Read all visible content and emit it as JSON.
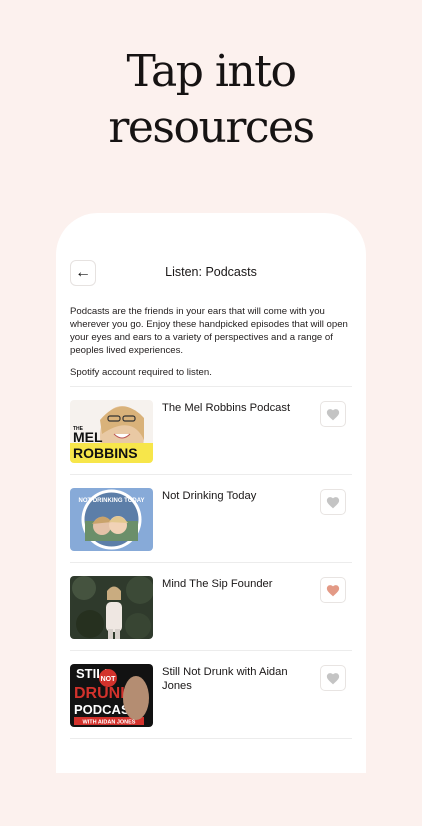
{
  "hero": {
    "line1": "Tap into",
    "line2": "resources"
  },
  "header": {
    "title": "Listen: Podcasts",
    "back_icon": "arrow-left-icon"
  },
  "intro_text": "Podcasts are the friends in your ears that will come with you wherever you go. Enjoy these handpicked episodes that will open your eyes and ears to a variety of perspectives and a range of peoples lived experiences.",
  "note_text": "Spotify account required to listen.",
  "podcasts": [
    {
      "title": "The Mel Robbins Podcast",
      "favorited": false,
      "art_text": [
        "THE",
        "MEL",
        "ROBBINS"
      ]
    },
    {
      "title": "Not Drinking Today",
      "favorited": false,
      "art_text": [
        "NOT DRINKING TODAY"
      ]
    },
    {
      "title": "Mind The Sip Founder",
      "favorited": true
    },
    {
      "title": "Still Not Drunk with Aidan Jones",
      "favorited": false,
      "art_text": [
        "STILL",
        "NOT",
        "DRUNK",
        "PODCAST",
        "WITH AIDAN JONES"
      ]
    }
  ],
  "colors": {
    "background": "#fcf1ee",
    "heart_inactive": "#c4c4c4",
    "heart_active": "#e39a86"
  }
}
